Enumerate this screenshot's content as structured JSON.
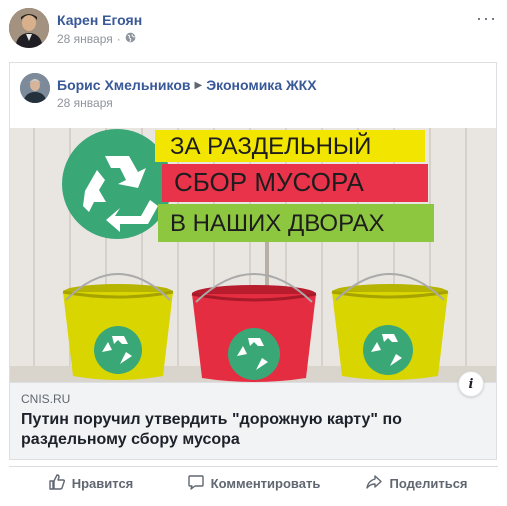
{
  "post": {
    "author": "Карен Егоян",
    "date": "28 января",
    "separator": "·",
    "privacy_icon": "globe-icon",
    "more_icon": "more-horizontal-icon",
    "more_label": "···"
  },
  "shared": {
    "author": "Борис Хмельников",
    "arrow": "▶",
    "group": "Экономика ЖКХ",
    "date": "28 января"
  },
  "link": {
    "image_lines": [
      "ЗА РАЗДЕЛЬНЫЙ",
      "СБОР МУСОРА",
      "В НАШИХ ДВОРАХ"
    ],
    "domain": "CNIS.RU",
    "title": "Путин поручил утвердить \"дорожную карту\" по раздельному сбору мусора",
    "info_label": "i"
  },
  "actions": {
    "like": "Нравится",
    "comment": "Комментировать",
    "share": "Поделиться"
  },
  "colors": {
    "link_blue": "#385898",
    "muted": "#90949c",
    "banner_yellow": "#f2e600",
    "banner_red": "#e8334a",
    "banner_green": "#8dc63f",
    "recycle_teal": "#3aa777"
  }
}
